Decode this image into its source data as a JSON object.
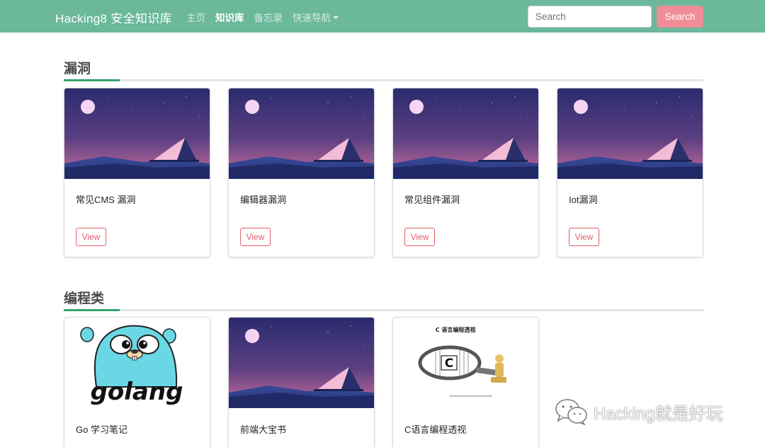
{
  "navbar": {
    "brand": "Hacking8 安全知识库",
    "links": [
      {
        "label": "主页",
        "active": false
      },
      {
        "label": "知识库",
        "active": true
      },
      {
        "label": "备忘录",
        "active": false
      },
      {
        "label": "快速导航",
        "active": false,
        "dropdown": true
      }
    ],
    "search": {
      "placeholder": "Search",
      "value": "",
      "button_label": "Search"
    }
  },
  "sections": [
    {
      "title": "漏洞",
      "cards": [
        {
          "title": "常见CMS 漏洞",
          "image": "mountain-landscape",
          "button_label": "View"
        },
        {
          "title": "编辑器漏洞",
          "image": "mountain-landscape",
          "button_label": "View"
        },
        {
          "title": "常见组件漏洞",
          "image": "mountain-landscape",
          "button_label": "View"
        },
        {
          "title": "Iot漏洞",
          "image": "mountain-landscape",
          "button_label": "View"
        }
      ]
    },
    {
      "title": "编程类",
      "cards": [
        {
          "title": "Go 学习笔记",
          "image": "golang-gopher",
          "logo_text": "golang"
        },
        {
          "title": "前端大宝书",
          "image": "mountain-landscape"
        },
        {
          "title": "C语言编程透视",
          "image": "c-book-cover",
          "cover_title": "C 语言编程透视",
          "cover_letter": "C"
        }
      ]
    }
  ],
  "watermark": {
    "text": "Hacking就是好玩",
    "icon": "wechat-icon"
  },
  "colors": {
    "navbar": "#6bb89b",
    "accent": "#33a36d",
    "search_button": "#f08d96",
    "view_button": "#e35d6a"
  }
}
